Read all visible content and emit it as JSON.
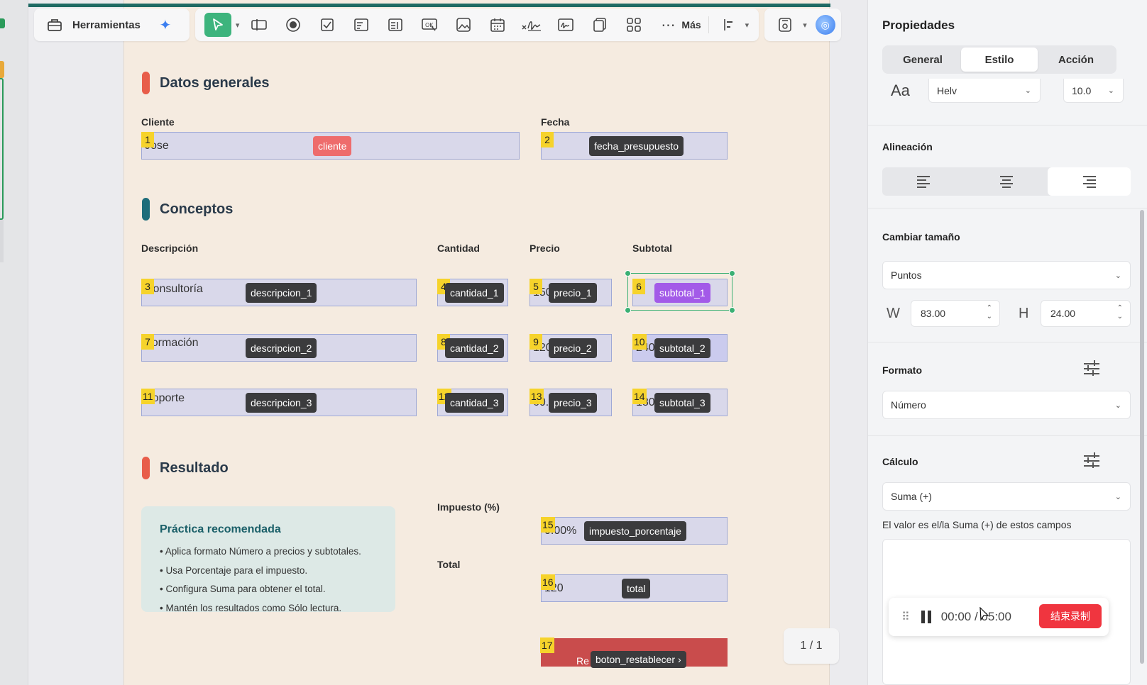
{
  "toolbar": {
    "tools_label": "Herramientas",
    "more_label": "Más"
  },
  "sections": {
    "general": "Datos generales",
    "concepts": "Conceptos",
    "result": "Resultado"
  },
  "labels": {
    "cliente": "Cliente",
    "fecha": "Fecha",
    "descripcion": "Descripción",
    "cantidad": "Cantidad",
    "precio": "Precio",
    "subtotal": "Subtotal",
    "impuesto": "Impuesto (%)",
    "total": "Total"
  },
  "fields": {
    "cliente": {
      "badge": "1",
      "value": "Jose",
      "tag": "cliente"
    },
    "fecha": {
      "badge": "2",
      "value": "",
      "tag": "fecha_presupuesto"
    },
    "descripcion_1": {
      "badge": "3",
      "value": "Consultoría",
      "tag": "descripcion_1"
    },
    "cantidad_1": {
      "badge": "4",
      "value": "",
      "tag": "cantidad_1"
    },
    "precio_1": {
      "badge": "5",
      "value": "150",
      "tag": "precio_1"
    },
    "subtotal_1": {
      "badge": "6",
      "value": "",
      "tag": "subtotal_1"
    },
    "descripcion_2": {
      "badge": "7",
      "value": "Formación",
      "tag": "descripcion_2"
    },
    "cantidad_2": {
      "badge": "8",
      "value": "",
      "tag": "cantidad_2"
    },
    "precio_2": {
      "badge": "9",
      "value": "120",
      "tag": "precio_2"
    },
    "subtotal_2": {
      "badge": "10",
      "value": "240",
      "tag": "subtotal_2"
    },
    "descripcion_3": {
      "badge": "11",
      "value": "Soporte",
      "tag": "descripcion_3"
    },
    "cantidad_3": {
      "badge": "12",
      "value": "",
      "tag": "cantidad_3"
    },
    "precio_3": {
      "badge": "13",
      "value": "60.",
      "tag": "precio_3"
    },
    "subtotal_3": {
      "badge": "14",
      "value": "180",
      "tag": "subtotal_3"
    },
    "impuesto": {
      "badge": "15",
      "value": "0.00%",
      "tag": "impuesto_porcentaje"
    },
    "total": {
      "badge": "16",
      "value": "120",
      "tag": "total"
    },
    "reset": {
      "badge": "17",
      "value": "Re",
      "tag": "boton_restablecer ›"
    }
  },
  "tip": {
    "title": "Práctica recomendada",
    "items": [
      "• Aplica formato Número a precios y subtotales.",
      "• Usa Porcentaje para el impuesto.",
      "• Configura Suma para obtener el total.",
      "• Mantén los resultados como Sólo lectura."
    ]
  },
  "page_indicator": "1 / 1",
  "panel": {
    "title": "Propiedades",
    "tabs": [
      "General",
      "Estilo",
      "Acción"
    ],
    "active_tab": "Estilo",
    "font_icon": "Aa",
    "font_name": "Helv",
    "font_size": "10.0",
    "alignment_label": "Alineación",
    "resize_label": "Cambiar tamaño",
    "resize_unit": "Puntos",
    "w_label": "W",
    "w_value": "83.00",
    "h_label": "H",
    "h_value": "24.00",
    "format_label": "Formato",
    "format_value": "Número",
    "calc_label": "Cálculo",
    "calc_value": "Suma (+)",
    "calc_desc": "El valor es el/la Suma (+) de estos campos"
  },
  "recorder": {
    "time": "00:00 / 05:00",
    "stop_label": "结束录制"
  },
  "colors": {
    "accent_green": "#3db47d",
    "field_bg": "#d9d8ea",
    "badge_yellow": "#f6d32b",
    "section_red": "#e85d4a",
    "section_teal": "#1e6d7a",
    "stop_red": "#f0353f"
  }
}
